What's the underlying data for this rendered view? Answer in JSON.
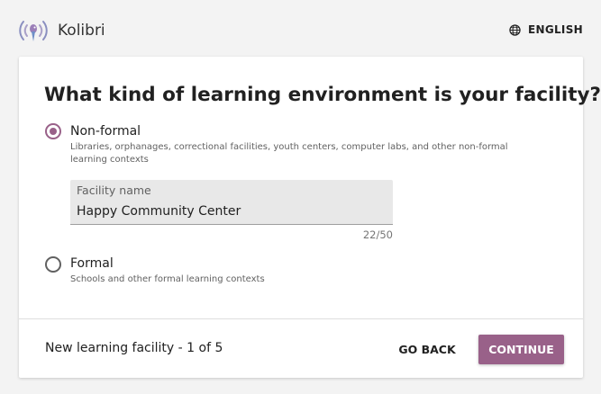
{
  "header": {
    "app_name": "Kolibri",
    "logo_icon": "kolibri-hummingbird-logo",
    "language_icon": "globe-icon",
    "language_label": "ENGLISH"
  },
  "form": {
    "heading": "What kind of learning environment is your facility?",
    "options": [
      {
        "label": "Non-formal",
        "description": "Libraries, orphanages, correctional facilities, youth centers, computer labs, and other non-formal learning contexts",
        "selected": true
      },
      {
        "label": "Formal",
        "description": "Schools and other formal learning contexts",
        "selected": false
      }
    ],
    "facility_name": {
      "label": "Facility name",
      "value": "Happy Community Center",
      "counter": "22/50"
    }
  },
  "footer": {
    "step_text": "New learning facility - 1 of 5",
    "back_label": "GO BACK",
    "continue_label": "CONTINUE"
  },
  "colors": {
    "accent": "#996189",
    "background": "#f3f3f3"
  }
}
